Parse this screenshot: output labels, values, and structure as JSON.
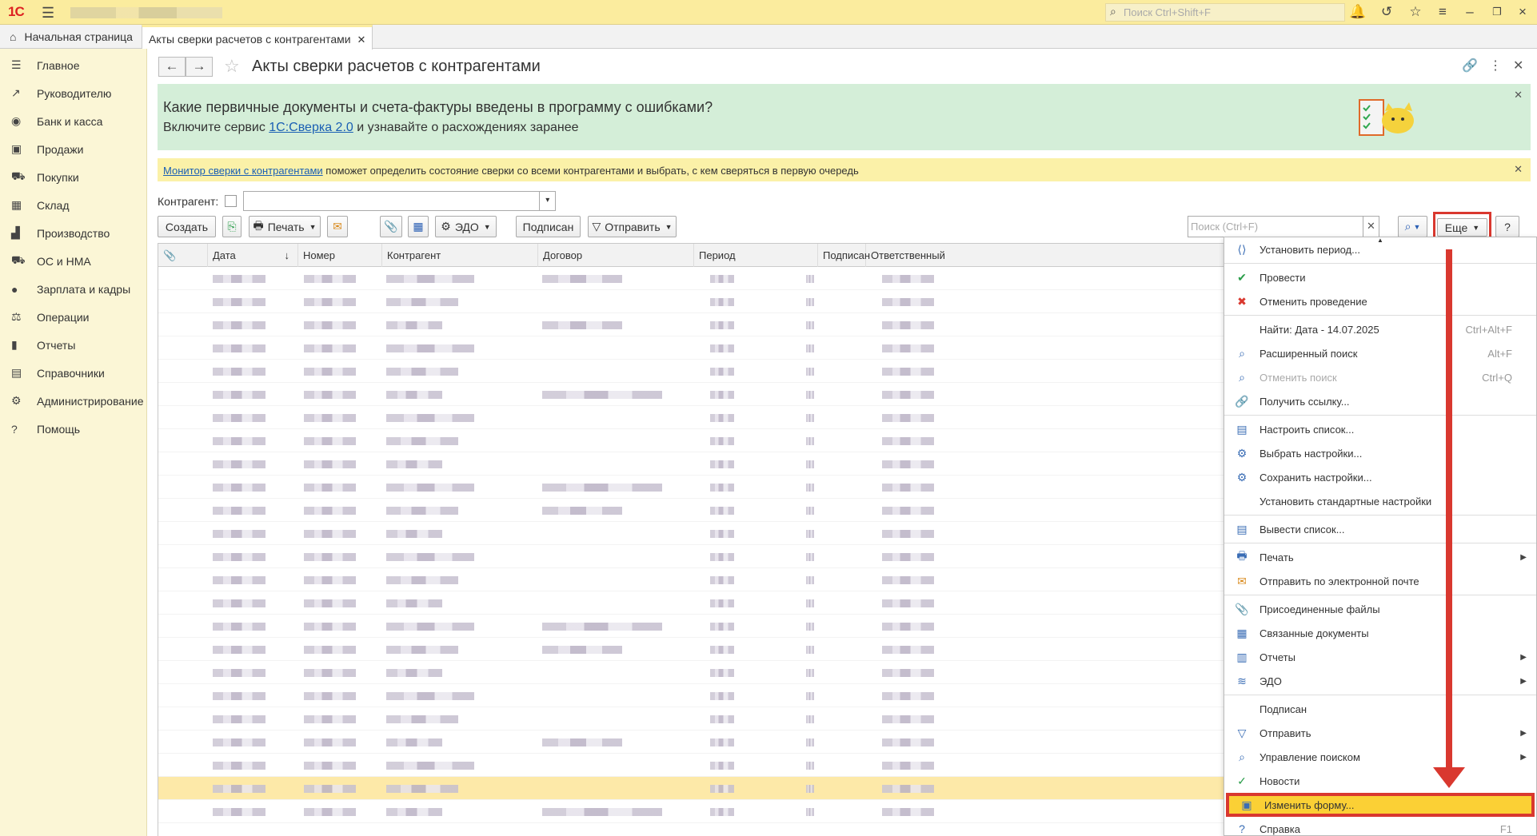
{
  "topbar": {
    "logo": "1С",
    "search_placeholder": "Поиск Ctrl+Shift+F"
  },
  "tabs": {
    "home_label": "Начальная страница",
    "active_label": "Акты сверки расчетов с контрагентами"
  },
  "sidebar": {
    "items": [
      {
        "icon": "menu-lines-icon",
        "label": "Главное"
      },
      {
        "icon": "trend-icon",
        "label": "Руководителю"
      },
      {
        "icon": "coin-icon",
        "label": "Банк и касса"
      },
      {
        "icon": "bag-icon",
        "label": "Продажи"
      },
      {
        "icon": "cart-icon",
        "label": "Покупки"
      },
      {
        "icon": "grid-icon",
        "label": "Склад"
      },
      {
        "icon": "factory-icon",
        "label": "Производство"
      },
      {
        "icon": "truck-icon",
        "label": "ОС и НМА"
      },
      {
        "icon": "person-icon",
        "label": "Зарплата и кадры"
      },
      {
        "icon": "operations-icon",
        "label": "Операции"
      },
      {
        "icon": "bar-chart-icon",
        "label": "Отчеты"
      },
      {
        "icon": "book-icon",
        "label": "Справочники"
      },
      {
        "icon": "gear-icon",
        "label": "Администрирование"
      },
      {
        "icon": "question-icon",
        "label": "Помощь"
      }
    ]
  },
  "page": {
    "title": "Акты сверки расчетов с контрагентами"
  },
  "banner_green": {
    "question": "Какие первичные документы и счета-фактуры введены в программу с ошибками?",
    "text_before": "Включите сервис ",
    "link": "1С:Сверка 2.0",
    "text_after": " и узнавайте о расхождениях заранее"
  },
  "banner_yellow": {
    "link": "Монитор сверки с контрагентами",
    "text": " поможет определить состояние сверки со всеми контрагентами и выбрать, с кем сверяться в первую очередь"
  },
  "filter": {
    "label": "Контрагент:"
  },
  "toolbar": {
    "create": "Создать",
    "print": "Печать",
    "edo": "ЭДО",
    "signed": "Подписан",
    "send": "Отправить",
    "search_placeholder": "Поиск (Ctrl+F)",
    "more": "Еще",
    "help": "?"
  },
  "table": {
    "columns": [
      "Дата",
      "Номер",
      "Контрагент",
      "Договор",
      "Период",
      "Подписан",
      "Ответственный"
    ]
  },
  "menu": {
    "items": [
      {
        "label": "Установить период...",
        "icon": "period-icon",
        "shortcut": "",
        "sub": false
      },
      {
        "sep": true
      },
      {
        "label": "Провести",
        "icon": "post-icon",
        "shortcut": "",
        "sub": false
      },
      {
        "label": "Отменить проведение",
        "icon": "unpost-icon",
        "shortcut": "",
        "sub": false
      },
      {
        "sep": true
      },
      {
        "label": "Найти: Дата - 14.07.2025",
        "icon": "",
        "shortcut": "Ctrl+Alt+F",
        "sub": false
      },
      {
        "label": "Расширенный поиск",
        "icon": "search-icon",
        "shortcut": "Alt+F",
        "sub": false
      },
      {
        "label": "Отменить поиск",
        "icon": "cancel-search-icon",
        "shortcut": "Ctrl+Q",
        "sub": false,
        "disabled": true
      },
      {
        "label": "Получить ссылку...",
        "icon": "link-icon",
        "shortcut": "",
        "sub": false
      },
      {
        "sep": true
      },
      {
        "label": "Настроить список...",
        "icon": "list-settings-icon",
        "shortcut": "",
        "sub": false
      },
      {
        "label": "Выбрать настройки...",
        "icon": "choose-settings-icon",
        "shortcut": "",
        "sub": false
      },
      {
        "label": "Сохранить настройки...",
        "icon": "save-settings-icon",
        "shortcut": "",
        "sub": false
      },
      {
        "label": "Установить стандартные настройки",
        "icon": "",
        "shortcut": "",
        "sub": false
      },
      {
        "sep": true
      },
      {
        "label": "Вывести список...",
        "icon": "output-list-icon",
        "shortcut": "",
        "sub": false
      },
      {
        "sep": true
      },
      {
        "label": "Печать",
        "icon": "printer-icon",
        "shortcut": "",
        "sub": true
      },
      {
        "label": "Отправить по электронной почте",
        "icon": "envelope-icon",
        "shortcut": "",
        "sub": false
      },
      {
        "sep": true
      },
      {
        "label": "Присоединенные файлы",
        "icon": "paperclip-icon",
        "shortcut": "",
        "sub": false
      },
      {
        "label": "Связанные документы",
        "icon": "related-docs-icon",
        "shortcut": "",
        "sub": false
      },
      {
        "label": "Отчеты",
        "icon": "reports-icon",
        "shortcut": "",
        "sub": true
      },
      {
        "label": "ЭДО",
        "icon": "edo-icon",
        "shortcut": "",
        "sub": true
      },
      {
        "sep": true
      },
      {
        "label": "Подписан",
        "icon": "",
        "shortcut": "",
        "sub": false
      },
      {
        "label": "Отправить",
        "icon": "send-icon",
        "shortcut": "",
        "sub": true
      },
      {
        "label": "Управление поиском",
        "icon": "search-manage-icon",
        "shortcut": "",
        "sub": true
      },
      {
        "label": "Новости",
        "icon": "check-icon",
        "shortcut": "",
        "sub": false
      },
      {
        "label": "Изменить форму...",
        "icon": "change-form-icon",
        "shortcut": "",
        "sub": false,
        "highlight": true
      },
      {
        "label": "Справка",
        "icon": "help-icon",
        "shortcut": "F1",
        "sub": false
      }
    ]
  },
  "colors": {
    "accent": "#fbec9e",
    "highlight": "#fbd035",
    "annotation": "#d9382f",
    "banner_green": "#d4eed8"
  }
}
